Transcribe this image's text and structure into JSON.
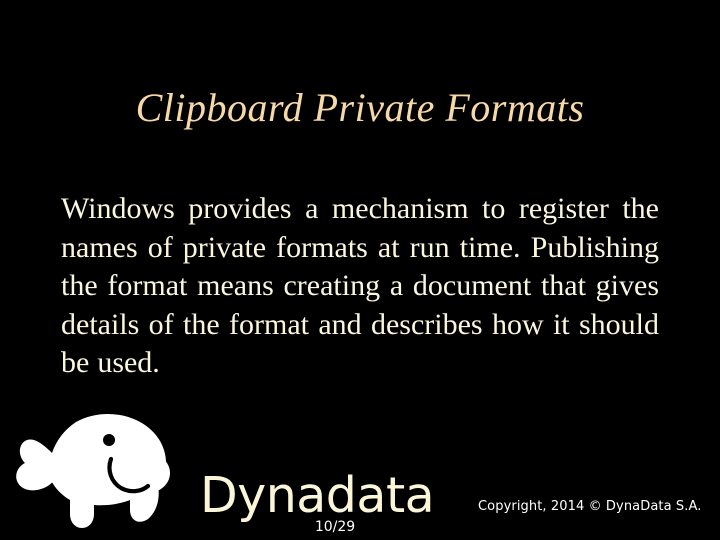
{
  "slide": {
    "background_color": "#000000",
    "title": "Clipboard Private Formats",
    "title_color": "#f7d9a8",
    "body_text": "Windows provides a mechanism to register the names of private formats at run time. Publishing the format means creating a document that gives details of the format and describes how it should be used.",
    "body_color": "#fbf7de"
  },
  "footer": {
    "logo_icon": "manatee-logo",
    "logo_color": "#ffffff",
    "wordmark": "Dynadata",
    "wordmark_color": "#fbf6d8",
    "copyright": "Copyright, 2014 © DynaData S.A.",
    "copyright_color": "#ffffff",
    "page_number": "10/29",
    "page_number_color": "#ffffff"
  }
}
